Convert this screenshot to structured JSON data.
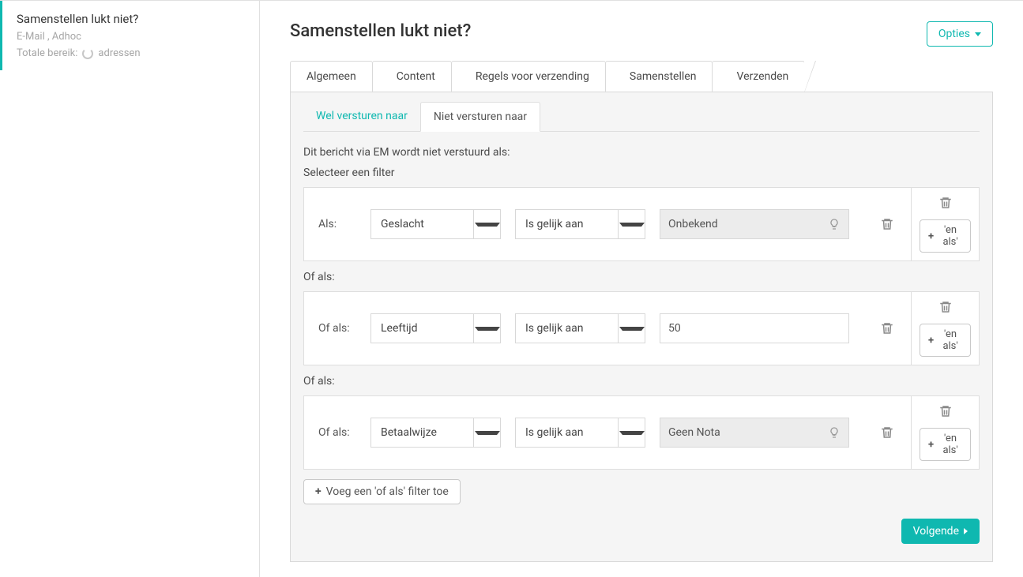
{
  "sidebar": {
    "title": "Samenstellen lukt niet?",
    "meta": "E-Mail , Adhoc",
    "reach_label": "Totale bereik:",
    "reach_unit": "adressen"
  },
  "header": {
    "title": "Samenstellen lukt niet?",
    "options_label": "Opties"
  },
  "tabs": [
    "Algemeen",
    "Content",
    "Regels voor verzending",
    "Samenstellen",
    "Verzenden"
  ],
  "subtabs": {
    "send": "Wel versturen naar",
    "not_send": "Niet versturen naar"
  },
  "lead": "Dit bericht via EM wordt niet verstuurd als:",
  "filter_head": "Selecteer een filter",
  "labels": {
    "als": "Als:",
    "of_als": "Of als:",
    "en_als_btn": "'en als'",
    "of_als_heading": "Of als:"
  },
  "operators": {
    "eq": "Is gelijk aan"
  },
  "rules": [
    {
      "label": "als",
      "field": "Geslacht",
      "op": "eq",
      "value": "Onbekend",
      "value_type": "readonly"
    },
    {
      "label": "of_als",
      "field": "Leeftijd",
      "op": "eq",
      "value": "50",
      "value_type": "input"
    },
    {
      "label": "of_als",
      "field": "Betaalwijze",
      "op": "eq",
      "value": "Geen Nota",
      "value_type": "readonly"
    }
  ],
  "add_of_als": "Voeg een 'of als' filter toe",
  "next": "Volgende"
}
